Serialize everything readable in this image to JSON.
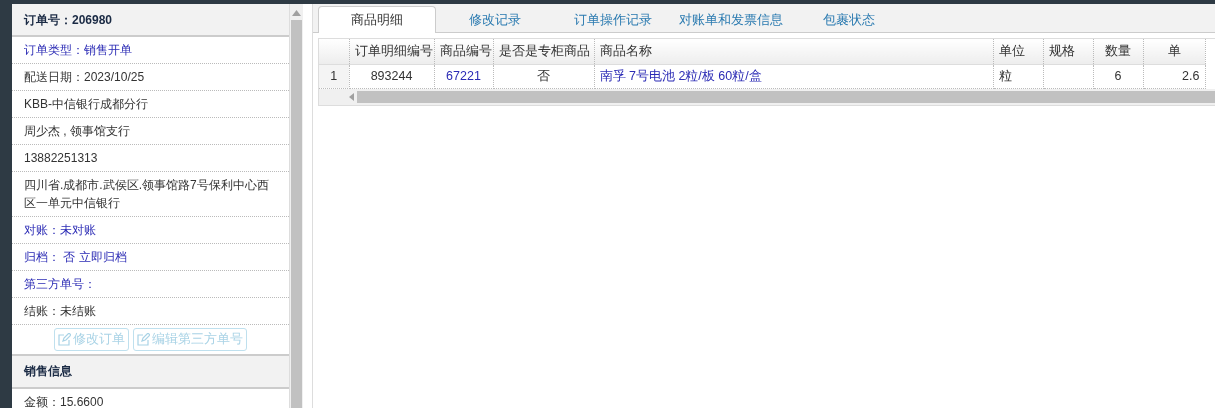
{
  "order_panel": {
    "title": "订单号：206980",
    "rows": [
      {
        "text": "订单类型：销售开单",
        "kind": "link"
      },
      {
        "text": "配送日期：2023/10/25",
        "kind": "plain"
      },
      {
        "text": "KBB-中信银行成都分行",
        "kind": "plain"
      },
      {
        "text": "周少杰 , 领事馆支行",
        "kind": "plain"
      },
      {
        "text": "13882251313",
        "kind": "plain"
      },
      {
        "text": "四川省.成都市.武侯区.领事馆路7号保利中心西区一单元中信银行",
        "kind": "plain"
      },
      {
        "text": "对账：未对账",
        "kind": "link"
      },
      {
        "text": "归档：  否 立即归档",
        "kind": "link"
      },
      {
        "text": "第三方单号：",
        "kind": "link"
      },
      {
        "text": "结账：未结账",
        "kind": "plain"
      }
    ],
    "buttons": [
      {
        "label": "修改订单",
        "disabled": true
      },
      {
        "label": "编辑第三方单号",
        "disabled": true
      }
    ]
  },
  "sales_panel": {
    "title": "销售信息",
    "rows": [
      {
        "text": "金额：15.6600",
        "kind": "plain"
      }
    ]
  },
  "tabs": [
    {
      "label": "商品明细",
      "selected": true
    },
    {
      "label": "修改记录",
      "selected": false
    },
    {
      "label": "订单操作记录",
      "selected": false
    },
    {
      "label": "对账单和发票信息",
      "selected": false
    },
    {
      "label": "包裹状态",
      "selected": false
    }
  ],
  "table": {
    "columns": [
      "订单明细编号",
      "商品编号",
      "是否是专柜商品",
      "商品名称",
      "单位",
      "规格",
      "数量",
      "单"
    ],
    "rows": [
      {
        "index": "1",
        "cells": [
          {
            "text": "893244",
            "kind": "plain"
          },
          {
            "text": "67221",
            "kind": "link"
          },
          {
            "text": "否",
            "kind": "plain"
          },
          {
            "text": "南孚 7号电池 2粒/板 60粒/盒",
            "kind": "link"
          },
          {
            "text": "粒",
            "kind": "plain"
          },
          {
            "text": "",
            "kind": "plain"
          },
          {
            "text": "6",
            "kind": "plain"
          },
          {
            "text": "2.6",
            "kind": "plain"
          }
        ]
      }
    ]
  }
}
